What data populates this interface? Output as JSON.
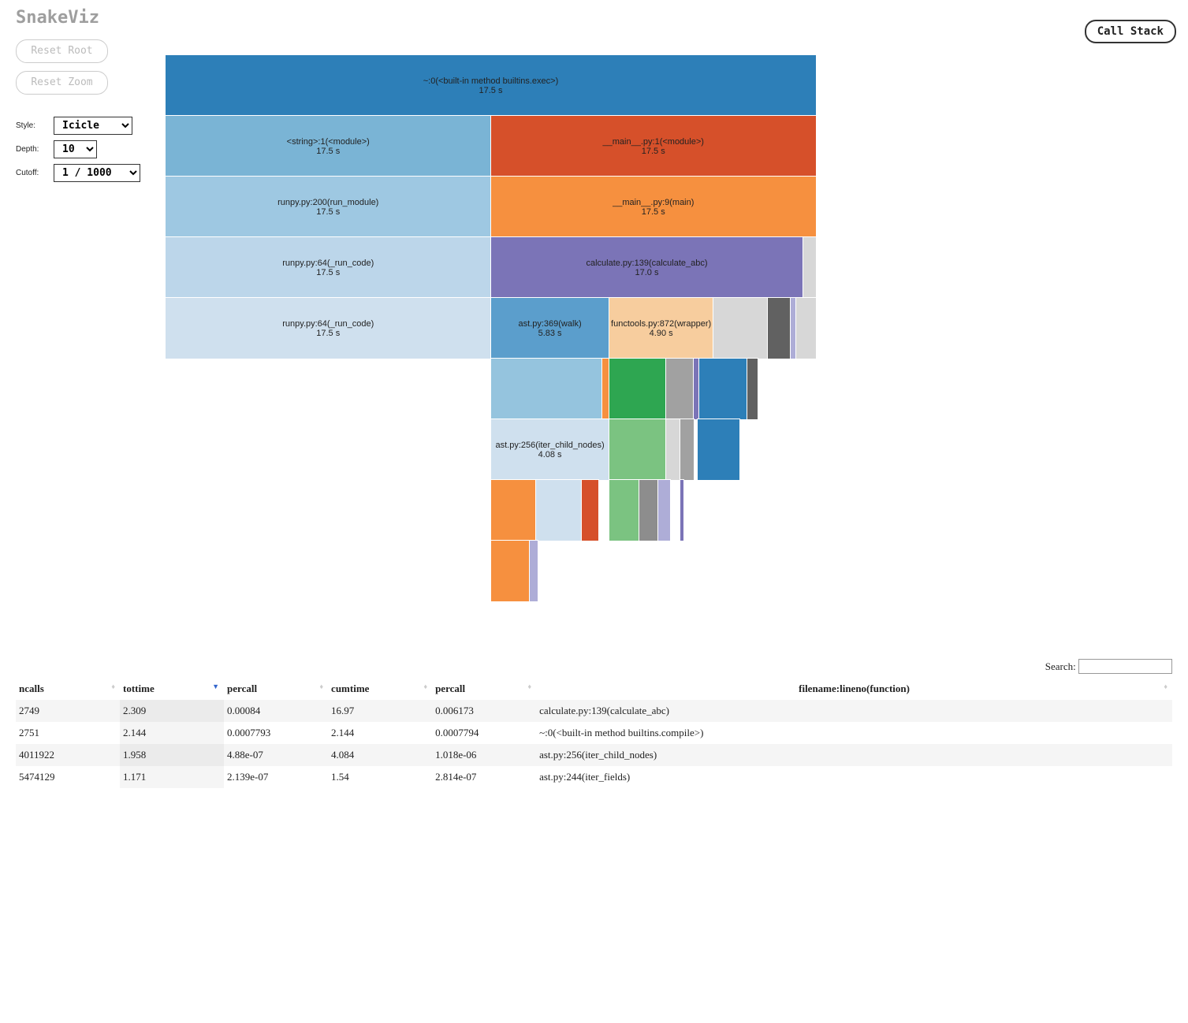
{
  "title": "SnakeViz",
  "buttons": {
    "reset_root": "Reset Root",
    "reset_zoom": "Reset Zoom",
    "call_stack": "Call Stack"
  },
  "controls": {
    "style_label": "Style:",
    "style_value": "Icicle",
    "depth_label": "Depth:",
    "depth_value": "10",
    "cutoff_label": "Cutoff:",
    "cutoff_value": "1 / 1000"
  },
  "chart_data": {
    "type": "icicle",
    "total_time_s": 17.5,
    "rows": [
      [
        {
          "label": "~:0(<built-in method builtins.exec>)",
          "time": "17.5 s",
          "w": 1.0,
          "color": "#2d7fb8"
        }
      ],
      [
        {
          "label": "<string>:1(<module>)",
          "time": "17.5 s",
          "w": 0.5,
          "color": "#7ab4d5"
        },
        {
          "label": "__main__.py:1(<module>)",
          "time": "17.5 s",
          "w": 0.5,
          "color": "#d6502a"
        }
      ],
      [
        {
          "label": "runpy.py:200(run_module)",
          "time": "17.5 s",
          "w": 0.5,
          "color": "#9ec8e2"
        },
        {
          "label": "__main__.py:9(main)",
          "time": "17.5 s",
          "w": 0.5,
          "color": "#f6903f"
        }
      ],
      [
        {
          "label": "runpy.py:64(_run_code)",
          "time": "17.5 s",
          "w": 0.5,
          "color": "#bcd6ea"
        },
        {
          "label": "calculate.py:139(calculate_abc)",
          "time": "17.0 s",
          "w": 0.48,
          "color": "#7b74b7"
        },
        {
          "label": "",
          "time": "",
          "w": 0.02,
          "color": "#d7d7d7"
        }
      ],
      [
        {
          "label": "runpy.py:64(_run_code)",
          "time": "17.5 s",
          "w": 0.5,
          "color": "#cfe0ee"
        },
        {
          "label": "ast.py:369(walk)",
          "time": "5.83 s",
          "w": 0.182,
          "color": "#5b9ecc"
        },
        {
          "label": "functools.py:872(wrapper)",
          "time": "4.90 s",
          "w": 0.16,
          "color": "#f7cd9e"
        },
        {
          "label": "",
          "time": "",
          "w": 0.084,
          "color": "#d7d7d7"
        },
        {
          "label": "",
          "time": "",
          "w": 0.035,
          "color": "#616161"
        },
        {
          "label": "",
          "time": "",
          "w": 0.009,
          "color": "#aeadd7"
        },
        {
          "label": "",
          "time": "",
          "w": 0.03,
          "color": "#d7d7d7"
        }
      ],
      [
        {
          "label": "",
          "time": "",
          "w": 0.5,
          "color": "transparent"
        },
        {
          "label": "",
          "time": "",
          "w": 0.172,
          "color": "#95c4de"
        },
        {
          "label": "",
          "time": "",
          "w": 0.01,
          "color": "#f6903f"
        },
        {
          "label": "",
          "time": "",
          "w": 0.088,
          "color": "#2ea651"
        },
        {
          "label": "",
          "time": "",
          "w": 0.042,
          "color": "#a1a1a1"
        },
        {
          "label": "",
          "time": "",
          "w": 0.009,
          "color": "#7b74b7"
        },
        {
          "label": "",
          "time": "",
          "w": 0.074,
          "color": "#2d7fb8"
        },
        {
          "label": "",
          "time": "",
          "w": 0.015,
          "color": "#616161"
        }
      ],
      [
        {
          "label": "",
          "time": "",
          "w": 0.5,
          "color": "transparent"
        },
        {
          "label": "ast.py:256(iter_child_nodes)",
          "time": "4.08 s",
          "w": 0.182,
          "color": "#cfe0ee"
        },
        {
          "label": "",
          "time": "",
          "w": 0.088,
          "color": "#7bc381"
        },
        {
          "label": "",
          "time": "",
          "w": 0.022,
          "color": "#d7d7d7"
        },
        {
          "label": "",
          "time": "",
          "w": 0.02,
          "color": "#a1a1a1"
        },
        {
          "label": "",
          "time": "",
          "w": 0.006,
          "color": "transparent"
        },
        {
          "label": "",
          "time": "",
          "w": 0.064,
          "color": "#2d7fb8"
        }
      ],
      [
        {
          "label": "",
          "time": "",
          "w": 0.5,
          "color": "transparent"
        },
        {
          "label": "",
          "time": "",
          "w": 0.07,
          "color": "#f6903f"
        },
        {
          "label": "",
          "time": "",
          "w": 0.07,
          "color": "#cfe0ee"
        },
        {
          "label": "",
          "time": "",
          "w": 0.025,
          "color": "#d6502a"
        },
        {
          "label": "",
          "time": "",
          "w": 0.017,
          "color": "transparent"
        },
        {
          "label": "",
          "time": "",
          "w": 0.046,
          "color": "#7bc381"
        },
        {
          "label": "",
          "time": "",
          "w": 0.03,
          "color": "#8d8d8d"
        },
        {
          "label": "",
          "time": "",
          "w": 0.018,
          "color": "#aeadd7"
        },
        {
          "label": "",
          "time": "",
          "w": 0.016,
          "color": "transparent"
        },
        {
          "label": "",
          "time": "",
          "w": 0.004,
          "color": "#7b74b7"
        }
      ],
      [
        {
          "label": "",
          "time": "",
          "w": 0.5,
          "color": "transparent"
        },
        {
          "label": "",
          "time": "",
          "w": 0.06,
          "color": "#f6903f"
        },
        {
          "label": "",
          "time": "",
          "w": 0.012,
          "color": "#aeadd7"
        }
      ]
    ]
  },
  "table": {
    "search_label": "Search:",
    "headers": [
      "ncalls",
      "tottime",
      "percall",
      "cumtime",
      "percall",
      "filename:lineno(function)"
    ],
    "sort_col": 1,
    "rows": [
      [
        "2749",
        "2.309",
        "0.00084",
        "16.97",
        "0.006173",
        "calculate.py:139(calculate_abc)"
      ],
      [
        "2751",
        "2.144",
        "0.0007793",
        "2.144",
        "0.0007794",
        "~:0(<built-in method builtins.compile>)"
      ],
      [
        "4011922",
        "1.958",
        "4.88e-07",
        "4.084",
        "1.018e-06",
        "ast.py:256(iter_child_nodes)"
      ],
      [
        "5474129",
        "1.171",
        "2.139e-07",
        "1.54",
        "2.814e-07",
        "ast.py:244(iter_fields)"
      ]
    ]
  }
}
